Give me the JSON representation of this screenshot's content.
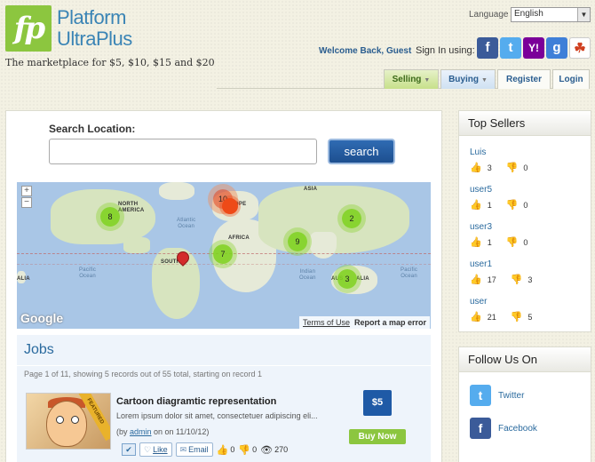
{
  "brand": {
    "logo_mark": "fp",
    "name_line1": "Platform",
    "name_line2": "UltraPlus",
    "tagline": "The marketplace for $5, $10, $15 and $20"
  },
  "language": {
    "label": "Language",
    "selected": "English"
  },
  "auth": {
    "welcome": "Welcome Back, Guest",
    "signin_label": "Sign In using:",
    "providers": [
      {
        "name": "facebook",
        "glyph": "f"
      },
      {
        "name": "twitter",
        "glyph": "t"
      },
      {
        "name": "yahoo",
        "glyph": "Y!"
      },
      {
        "name": "google",
        "glyph": "g"
      },
      {
        "name": "microsoft",
        "glyph": "☘"
      }
    ]
  },
  "nav": {
    "selling": "Selling",
    "buying": "Buying",
    "register": "Register",
    "login": "Login",
    "selected": "Selling"
  },
  "search": {
    "label": "Search Location:",
    "value": "",
    "placeholder": "",
    "button": "search"
  },
  "map": {
    "labels": {
      "north_america": "NORTH\nAMERICA",
      "europe": "OPE",
      "asia": "ASIA",
      "africa": "AFRICA",
      "south_america": "SOUTH",
      "australia": "AUS",
      "australia_tail": "ALIA",
      "left_edge": "ALIA",
      "atlantic": "Atlantic\nOcean",
      "pacific_left": "Pacific\nOcean",
      "pacific_right": "Pacific\nOcean",
      "indian": "Indian\nOcean"
    },
    "clusters": [
      {
        "id": "na",
        "count": "8",
        "hot": false
      },
      {
        "id": "eu",
        "count": "10",
        "hot": true
      },
      {
        "id": "asia",
        "count": "2",
        "hot": false
      },
      {
        "id": "africa",
        "count": "9",
        "hot": false
      },
      {
        "id": "sa",
        "count": "7",
        "hot": false
      },
      {
        "id": "aus",
        "count": "3",
        "hot": false
      }
    ],
    "zoom_in": "+",
    "zoom_out": "−",
    "terms": "Terms of Use",
    "report": "Report a map error",
    "google": "Google"
  },
  "jobs": {
    "title": "Jobs",
    "meta": "Page 1 of 11, showing 5 records out of 55 total, starting on record 1",
    "items": [
      {
        "title": "Cartoon diagramtic representation",
        "description": "Lorem ipsum dolor sit amet, consectetuer adipiscing eli...",
        "by_prefix": "(by ",
        "author": "admin",
        "by_suffix": " on on 11/10/12)",
        "price": "$5",
        "buy_label": "Buy Now",
        "ribbon": "FEATURED",
        "like_label": "Like",
        "email_label": "Email",
        "thumbs_up": "0",
        "thumbs_down": "0",
        "views": "270"
      }
    ]
  },
  "top_sellers": {
    "title": "Top Sellers",
    "items": [
      {
        "name": "Luis",
        "up": "3",
        "down": "0"
      },
      {
        "name": "user5",
        "up": "1",
        "down": "0"
      },
      {
        "name": "user3",
        "up": "1",
        "down": "0"
      },
      {
        "name": "user1",
        "up": "17",
        "down": "3"
      },
      {
        "name": "user",
        "up": "21",
        "down": "5"
      }
    ]
  },
  "follow": {
    "title": "Follow Us On",
    "items": [
      {
        "label": "Twitter",
        "glyph": "t"
      },
      {
        "label": "Facebook",
        "glyph": "f"
      }
    ]
  },
  "colors": {
    "brand_green": "#8cc63f",
    "brand_blue": "#3a84b5",
    "link_blue": "#2a6a9e",
    "button_blue": "#1f5aa6"
  }
}
